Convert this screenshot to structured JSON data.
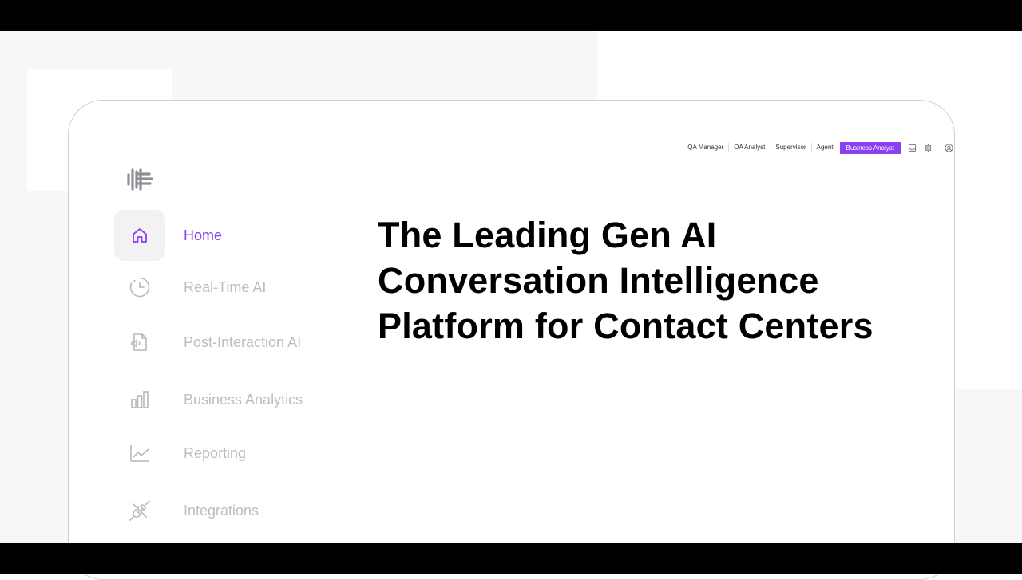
{
  "header": {
    "roles": [
      "QA Manager",
      "OA Analyst",
      "Supervisor",
      "Agent"
    ],
    "active_role": "Business Analyst",
    "icons": [
      "inbox-icon",
      "gear-icon",
      "user-icon"
    ],
    "accent_color": "#8a3ff0"
  },
  "logo": {
    "icon": "brand-logo-icon"
  },
  "sidebar": {
    "items": [
      {
        "label": "Home",
        "icon": "home-icon",
        "active": true
      },
      {
        "label": "Real-Time AI",
        "icon": "clock-icon",
        "active": false
      },
      {
        "label": "Post-Interaction AI",
        "icon": "audio-file-icon",
        "active": false
      },
      {
        "label": "Business Analytics",
        "icon": "bar-chart-icon",
        "active": false
      },
      {
        "label": "Reporting",
        "icon": "line-chart-icon",
        "active": false
      },
      {
        "label": "Integrations",
        "icon": "plug-icon",
        "active": false
      }
    ]
  },
  "hero": {
    "title_lines": [
      "The Leading Gen AI",
      "Conversation Intelligence",
      "Platform for Contact Centers"
    ]
  }
}
